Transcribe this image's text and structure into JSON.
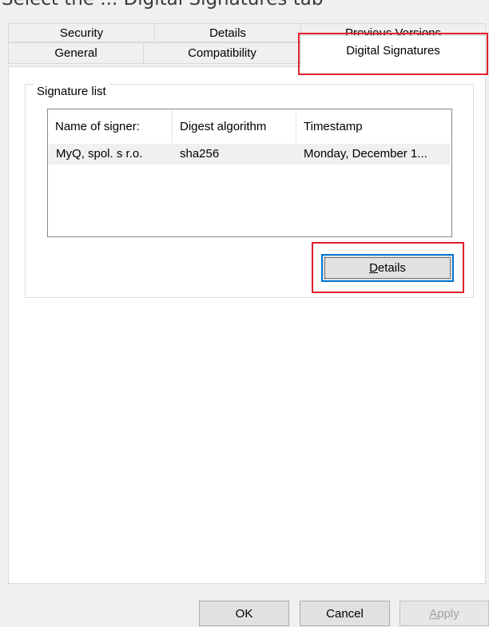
{
  "top_caption": "Select the ... Digital Signatures tab",
  "tabs": {
    "back": [
      {
        "label": "Security"
      },
      {
        "label": "Details"
      },
      {
        "label": "Previous Versions"
      }
    ],
    "front": [
      {
        "label": "General"
      },
      {
        "label": "Compatibility"
      },
      {
        "label": "Digital Signatures",
        "selected": true
      }
    ]
  },
  "signature_list": {
    "legend": "Signature list",
    "columns": [
      "Name of signer:",
      "Digest algorithm",
      "Timestamp"
    ],
    "rows": [
      {
        "signer": "MyQ, spol. s r.o.",
        "digest": "sha256",
        "timestamp": "Monday, December 1..."
      }
    ],
    "details_button": {
      "mnemonic": "D",
      "rest": "etails"
    }
  },
  "footer": {
    "ok": "OK",
    "cancel": "Cancel",
    "apply": {
      "mnemonic": "A",
      "rest": "pply"
    }
  },
  "colors": {
    "highlight": "#e0202a",
    "focus": "#0078d7",
    "selected_row": "#f0f0f0"
  }
}
